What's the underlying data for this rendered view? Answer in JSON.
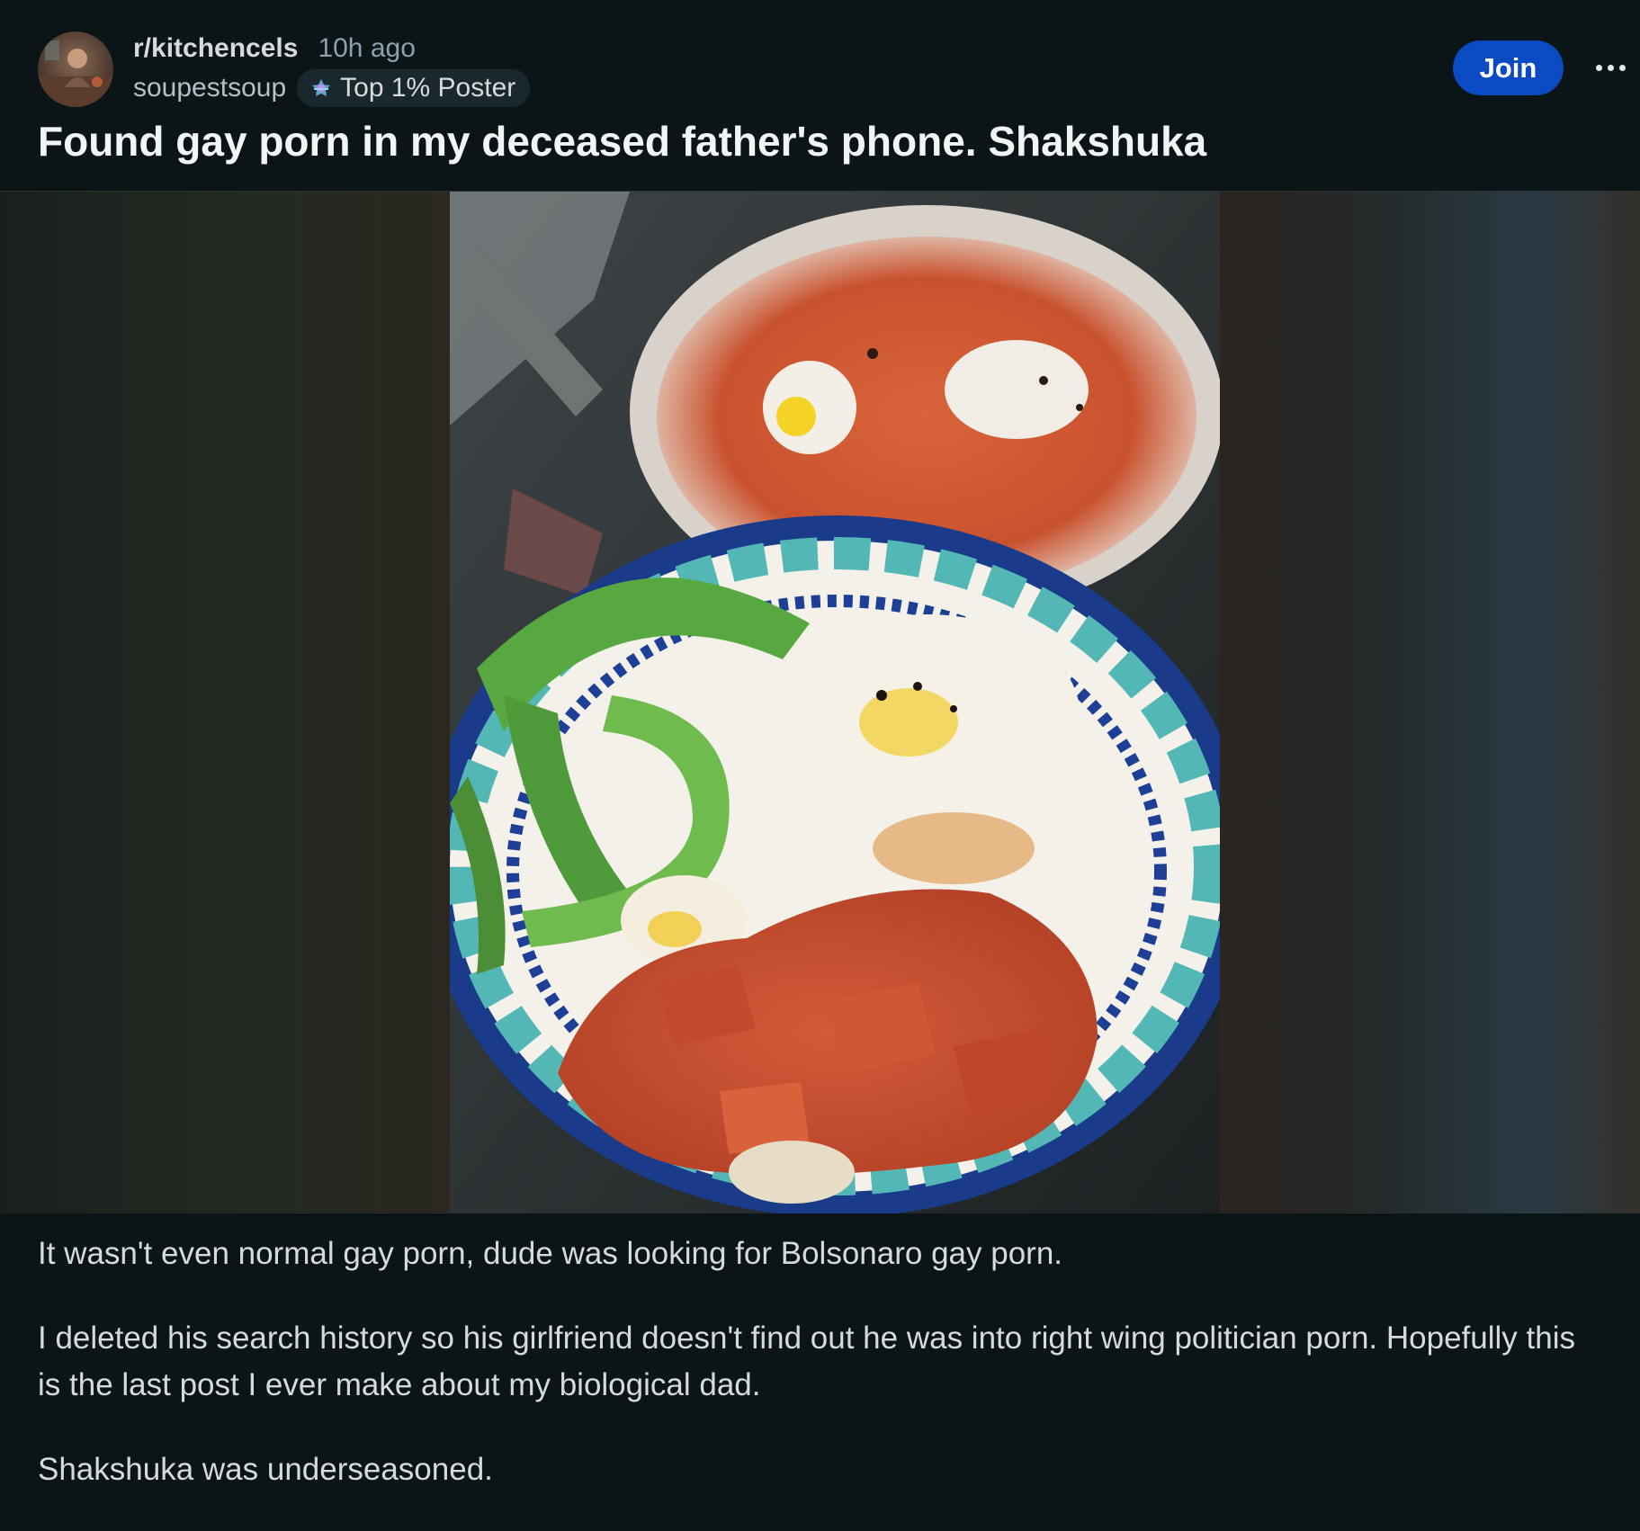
{
  "post": {
    "subreddit": "r/kitchencels",
    "time_ago": "10h ago",
    "author": "soupestsoup",
    "flair": "Top 1% Poster",
    "title": "Found gay porn in my deceased father's phone. Shakshuka",
    "body": [
      "It wasn't even normal gay porn, dude was looking for Bolsonaro gay porn.",
      "I deleted his search history so his girlfriend doesn't find out he was into right wing politician porn. Hopefully this is the last post I ever make about my biological dad.",
      "Shakshuka was underseasoned."
    ]
  },
  "actions": {
    "join_label": "Join"
  },
  "icons": {
    "avatar": "subreddit-avatar",
    "flair": "top-poster-badge-icon",
    "more": "more-options-icon"
  },
  "colors": {
    "background": "#0b1416",
    "join_button": "#0a4ac2",
    "flair_bg": "#1a282d",
    "muted_text": "#8ba2ad"
  }
}
